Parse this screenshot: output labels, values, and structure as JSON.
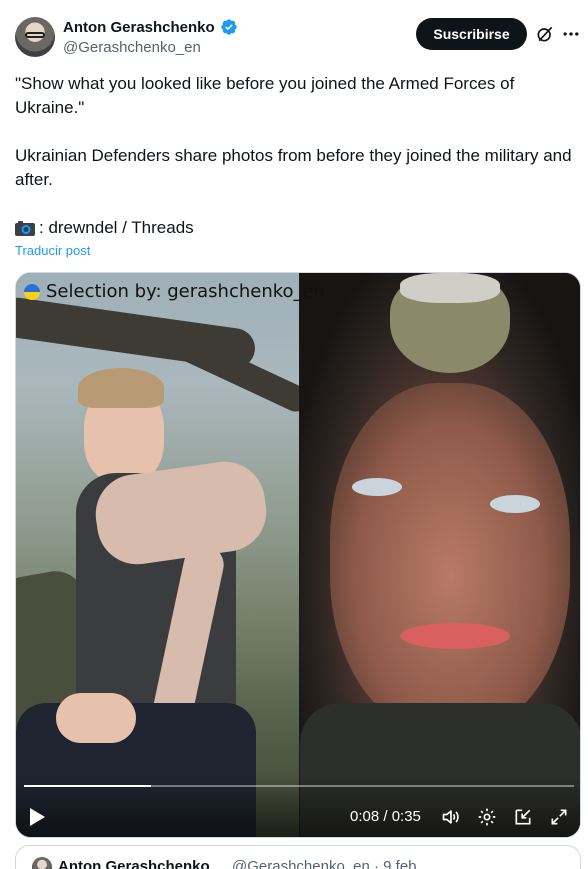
{
  "author": {
    "name": "Anton Gerashchenko",
    "handle": "@Gerashchenko_en",
    "verified": true
  },
  "subscribe_label": "Suscribirse",
  "icons": {
    "grok": "grok-slash-icon",
    "more": "more-dots-icon",
    "verified": "verified-badge-icon",
    "camera": "camera-emoji-icon",
    "play": "play-icon",
    "volume": "volume-icon",
    "settings": "gear-icon",
    "pip": "picture-in-picture-icon",
    "fullscreen": "fullscreen-icon"
  },
  "post": {
    "line1": "\"Show what you looked like before you joined the Armed Forces of Ukraine.\"",
    "line2": "Ukrainian Defenders share photos from before they joined the military and after.",
    "credit": ": drewndel / Threads",
    "translate": "Traducir post"
  },
  "media": {
    "watermark": "Selection by: gerashchenko_en",
    "time": "0:08 / 0:35",
    "progress_fraction": 0.23
  },
  "quoted": {
    "name": "Anton Gerashchenko",
    "meta": "@Gerashchenko_en · 9 feb"
  },
  "colors": {
    "accent": "#1d9bf0",
    "button_bg": "#0f1419",
    "secondary_text": "#536471"
  }
}
